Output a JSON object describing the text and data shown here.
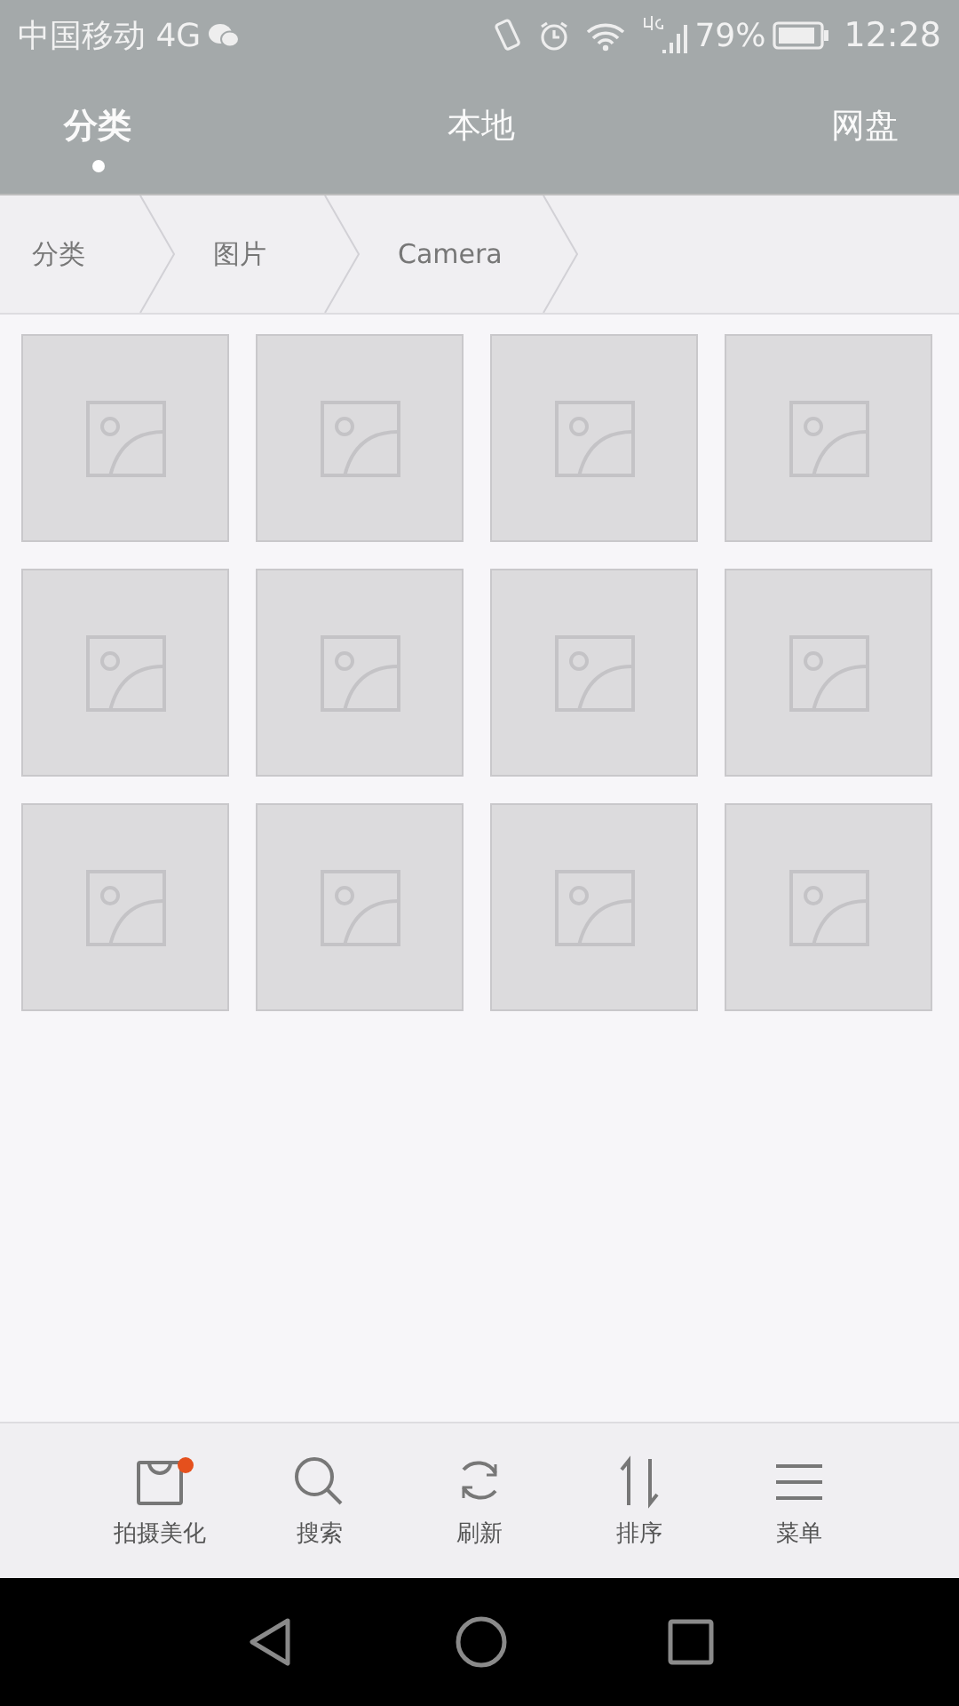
{
  "status_bar": {
    "carrier": "中国移动 4G",
    "battery": "79%",
    "time": "12:28"
  },
  "tabs": [
    {
      "label": "分类",
      "selected": true
    },
    {
      "label": "本地",
      "selected": false
    },
    {
      "label": "网盘",
      "selected": false
    }
  ],
  "breadcrumb": [
    "分类",
    "图片",
    "Camera"
  ],
  "thumbnails": [
    {
      "kind": "placeholder"
    },
    {
      "kind": "placeholder"
    },
    {
      "kind": "placeholder"
    },
    {
      "kind": "placeholder"
    },
    {
      "kind": "placeholder"
    },
    {
      "kind": "placeholder"
    },
    {
      "kind": "placeholder"
    },
    {
      "kind": "placeholder"
    },
    {
      "kind": "placeholder"
    },
    {
      "kind": "placeholder"
    },
    {
      "kind": "placeholder"
    },
    {
      "kind": "placeholder"
    }
  ],
  "toolbar": [
    {
      "kind": "bag",
      "label": "拍摄美化",
      "badge": true
    },
    {
      "kind": "search",
      "label": "搜索",
      "badge": false
    },
    {
      "kind": "refresh",
      "label": "刷新",
      "badge": false
    },
    {
      "kind": "sort",
      "label": "排序",
      "badge": false
    },
    {
      "kind": "menu",
      "label": "菜单",
      "badge": false
    }
  ]
}
